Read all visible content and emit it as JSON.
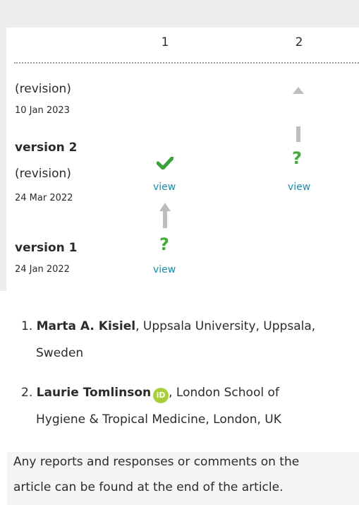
{
  "reviewers_table": {
    "columns": [
      "1",
      "2"
    ],
    "rows": [
      {
        "label": "(revision)",
        "date": "10 Jan 2023"
      },
      {
        "version": "version 2",
        "label": "(revision)",
        "date": "24 Mar 2022",
        "col1": {
          "status": "approved",
          "icon": "check-icon",
          "link": "view"
        },
        "col2": {
          "status": "pending",
          "icon": "question-icon",
          "link": "view"
        }
      },
      {
        "version": "version 1",
        "date": "24 Jan 2022",
        "col1": {
          "status": "pending",
          "icon": "question-icon",
          "link": "view"
        }
      }
    ]
  },
  "authors": [
    {
      "number": "1.",
      "name": "Marta A. Kisiel",
      "affiliation": ", Uppsala University, Uppsala,",
      "affiliation_cont": "Sweden"
    },
    {
      "number": "2.",
      "name": "Laurie Tomlinson",
      "orcid_label": "iD",
      "affiliation": ", London School of",
      "affiliation_cont": "Hygiene & Tropical Medicine, London, UK"
    }
  ],
  "footer_note": {
    "line1": "Any reports and responses or comments on the",
    "line2": "article can be found at the end of the article."
  },
  "colors": {
    "check": "#3aa03a",
    "question": "#44aa3a",
    "link": "#1a8ea8",
    "arrow": "#bdbdbd",
    "orcid": "#a6ce39"
  }
}
